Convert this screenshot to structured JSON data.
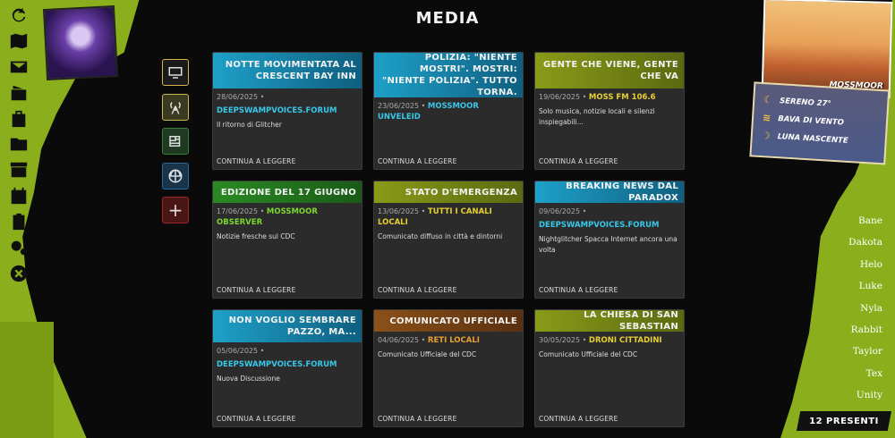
{
  "page": {
    "title": "MEDIA"
  },
  "colors": {
    "lime": "#8aae1c",
    "cyan": "#38c8e8",
    "yellow": "#e8d030",
    "green": "#7ad82e",
    "orange": "#e8a030"
  },
  "left_icons": [
    "refresh-icon",
    "map-icon",
    "mail-icon",
    "radio-icon",
    "luggage-icon",
    "folder-icon",
    "archive-icon",
    "calendar-icon",
    "clipboard-icon",
    "gears-icon",
    "close-icon"
  ],
  "media_buttons": [
    "tv-icon",
    "radio-tower-icon",
    "newspaper-icon",
    "globe-icon",
    "plus-icon"
  ],
  "media_plus_label": "+",
  "cards": [
    {
      "title": "NOTTE MOVIMENTATA AL CRESCENT BAY INN",
      "date": "28/06/2025",
      "source": "DEEPSWAMPVOICES.FORUM",
      "desc": "Il ritorno di Glitcher",
      "more": "CONTINUA A LEGGERE"
    },
    {
      "title": "POLIZIA: \"NIENTE MOSTRI\". MOSTRI: \"NIENTE POLIZIA\". TUTTO TORNA.",
      "date": "23/06/2025",
      "source": "MOSSMOOR UNVELEID",
      "desc": "",
      "more": "CONTINUA A LEGGERE"
    },
    {
      "title": "GENTE CHE VIENE, GENTE CHE VA",
      "date": "19/06/2025",
      "source": "MOSS FM 106.6",
      "desc": "Solo musica, notizie locali e silenzi inspiegabili...",
      "more": "CONTINUA A LEGGERE"
    },
    {
      "title": "EDIZIONE DEL 17 GIUGNO",
      "date": "17/06/2025",
      "source": "MOSSMOOR OBSERVER",
      "desc": "Notizie fresche sul CDC",
      "more": "CONTINUA A LEGGERE"
    },
    {
      "title": "STATO D'EMERGENZA",
      "date": "13/06/2025",
      "source": "TUTTI I CANALI LOCALI",
      "desc": "Comunicato diffuso in città e dintorni",
      "more": "CONTINUA A LEGGERE"
    },
    {
      "title": "BREAKING NEWS DAL PARADOX",
      "date": "09/06/2025",
      "source": "DEEPSWAMPVOICES.FORUM",
      "desc": "Nightglitcher Spacca Internet ancora una volta",
      "more": "CONTINUA A LEGGERE"
    },
    {
      "title": "NON VOGLIO SEMBRARE PAZZO, MA...",
      "date": "05/06/2025",
      "source": "DEEPSWAMPVOICES.FORUM",
      "desc": "Nuova Discussione",
      "more": "CONTINUA A LEGGERE"
    },
    {
      "title": "COMUNICATO UFFICIALE",
      "date": "04/06/2025",
      "source": "RETI LOCALI",
      "desc": "Comunicato Ufficiale del CDC",
      "more": "CONTINUA A LEGGERE"
    },
    {
      "title": "LA CHIESA DI SAN SEBASTIAN",
      "date": "30/05/2025",
      "source": "DRONI CITTADINI",
      "desc": "Comunicato Ufficiale del CDC",
      "more": "CONTINUA A LEGGERE"
    }
  ],
  "weather": {
    "city": "MOSSMOOR",
    "rows": [
      {
        "icon": "moon-icon",
        "text": "SERENO 27°"
      },
      {
        "icon": "wind-icon",
        "text": "BAVA DI VENTO"
      },
      {
        "icon": "moon-phase-icon",
        "text": "LUNA NASCENTE"
      }
    ]
  },
  "users": [
    "Bane",
    "Dakota",
    "Helo",
    "Luke",
    "Nyla",
    "Rabbit",
    "Taylor",
    "Tex",
    "Unity"
  ],
  "present": "12 PRESENTI"
}
